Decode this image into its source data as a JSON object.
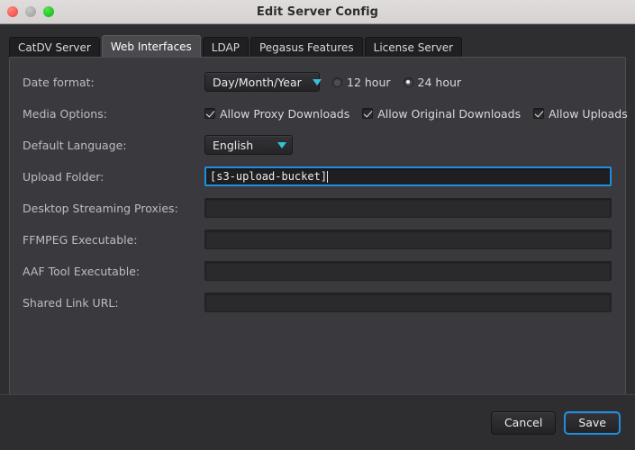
{
  "window": {
    "title": "Edit Server Config",
    "traffic_lights": [
      {
        "name": "close-button",
        "color": "#f2544b"
      },
      {
        "name": "minimize-button",
        "color": "#a8a8a8"
      },
      {
        "name": "zoom-button",
        "color": "#1fc41f"
      }
    ]
  },
  "tabs": [
    {
      "label": "CatDV Server",
      "active": false
    },
    {
      "label": "Web Interfaces",
      "active": true
    },
    {
      "label": "LDAP",
      "active": false
    },
    {
      "label": "Pegasus Features",
      "active": false
    },
    {
      "label": "License Server",
      "active": false
    }
  ],
  "form": {
    "date_format": {
      "label": "Date format:",
      "selected": "Day/Month/Year",
      "caret_icon": "chevron-down-icon",
      "caret_color": "#34c3d4"
    },
    "clock": {
      "options": [
        {
          "label": "12 hour",
          "selected": false
        },
        {
          "label": "24 hour",
          "selected": true
        }
      ]
    },
    "media_options": {
      "label": "Media Options:",
      "checkboxes": [
        {
          "label": "Allow Proxy Downloads",
          "checked": true
        },
        {
          "label": "Allow Original Downloads",
          "checked": true
        },
        {
          "label": "Allow Uploads",
          "checked": true
        }
      ]
    },
    "default_language": {
      "label": "Default Language:",
      "selected": "English",
      "caret_icon": "chevron-down-icon"
    },
    "upload_folder": {
      "label": "Upload Folder:",
      "value": "[s3-upload-bucket]",
      "focused": true
    },
    "desktop_streaming_proxies": {
      "label": "Desktop Streaming Proxies:",
      "value": ""
    },
    "ffmpeg_executable": {
      "label": "FFMPEG Executable:",
      "value": ""
    },
    "aaf_tool_executable": {
      "label": "AAF Tool Executable:",
      "value": ""
    },
    "shared_link_url": {
      "label": "Shared Link URL:",
      "value": ""
    }
  },
  "footer": {
    "cancel_label": "Cancel",
    "save_label": "Save",
    "focus_color": "#1e8fe0"
  }
}
